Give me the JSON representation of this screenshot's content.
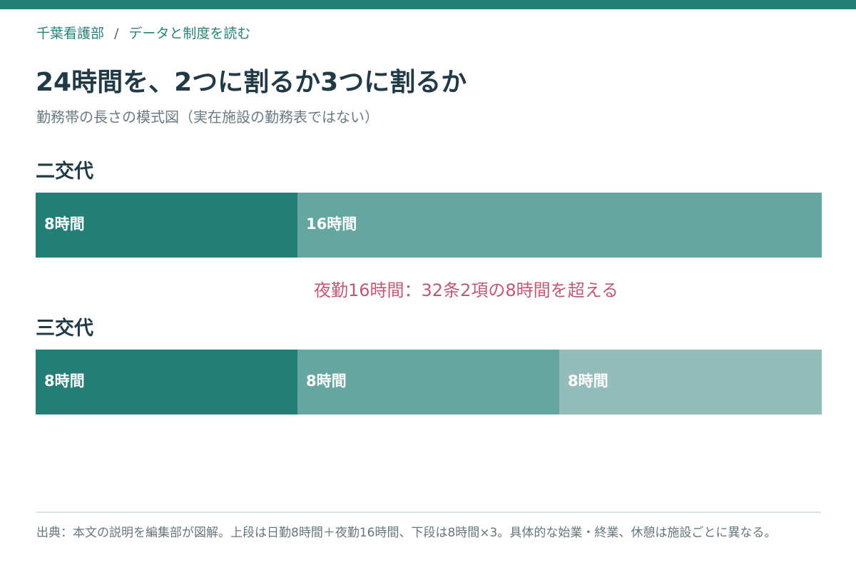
{
  "colors": {
    "top_bar": "#237e78",
    "shift1": "#237e78",
    "shift2": "#66a6a1",
    "shift3": "#94bcb8",
    "annotation": "#c05a72"
  },
  "breadcrumb": {
    "site": "千葉看護部",
    "separator": "/",
    "section": "データと制度を読む"
  },
  "header": {
    "title": "24時間を、2つに割るか3つに割るか",
    "subtitle": "勤務帯の長さの模式図（実在施設の勤務表ではない）"
  },
  "chart_data": {
    "type": "bar",
    "orientation": "horizontal",
    "stacked": true,
    "total_hours": 24,
    "rows": [
      {
        "name": "二交代",
        "segments": [
          {
            "label": "8時間",
            "hours": 8,
            "color": "#237e78"
          },
          {
            "label": "16時間",
            "hours": 16,
            "color": "#66a6a1"
          }
        ]
      },
      {
        "name": "三交代",
        "segments": [
          {
            "label": "8時間",
            "hours": 8,
            "color": "#237e78"
          },
          {
            "label": "8時間",
            "hours": 8,
            "color": "#66a6a1"
          },
          {
            "label": "8時間",
            "hours": 8,
            "color": "#94bcb8"
          }
        ]
      }
    ],
    "annotation": "夜勤16時間：32条2項の8時間を超える",
    "grid": false,
    "legend": "none"
  },
  "footer": {
    "source": "出典：本文の説明を編集部が図解。上段は日勤8時間＋夜勤16時間、下段は8時間×3。具体的な始業・終業、休憩は施設ごとに異なる。"
  }
}
